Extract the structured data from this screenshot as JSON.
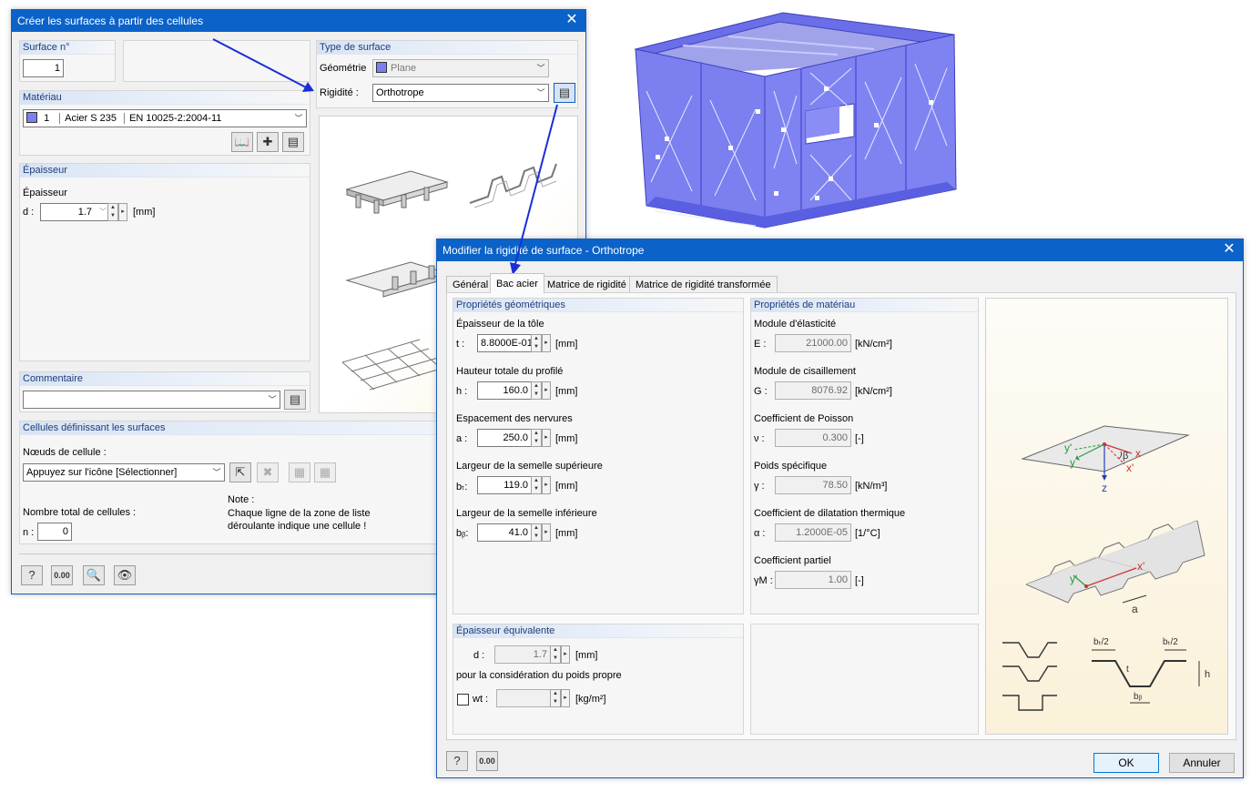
{
  "dialog1": {
    "title": "Créer les surfaces à partir des cellules",
    "surface_label": "Surface n°",
    "surface_no": "1",
    "type_label": "Type de surface",
    "geometry_label": "Géométrie",
    "geometry_value": "Plane",
    "rigidity_label": "Rigidité :",
    "rigidity_value": "Orthotrope",
    "material_label": "Matériau",
    "material_no": "1",
    "material_name": "Acier S 235",
    "material_norm": "EN 10025-2:2004-11",
    "thickness_group": "Épaisseur",
    "thickness_label": "Épaisseur",
    "d_label": "d :",
    "d_value": "1.7",
    "d_unit": "[mm]",
    "comment_label": "Commentaire",
    "comment_value": "",
    "cells_group": "Cellules définissant les surfaces",
    "nodes_label": "Nœuds de cellule :",
    "nodes_value": "Appuyez sur l'icône [Sélectionner]",
    "total_label": "Nombre total de cellules :",
    "n_label": "n :",
    "n_value": "0",
    "note_title": "Note :",
    "note_line1": "Chaque ligne de la zone de liste",
    "note_line2": "déroulante indique une cellule !"
  },
  "dialog2": {
    "title": "Modifier la rigidité de surface - Orthotrope",
    "tabs": [
      "Général",
      "Bac acier",
      "Matrice de rigidité",
      "Matrice de rigidité transformée"
    ],
    "geo_group": "Propriétés géométriques",
    "geo": [
      {
        "label": "Épaisseur de la tôle",
        "sym": "t :",
        "value": "8.8000E-01",
        "unit": "[mm]"
      },
      {
        "label": "Hauteur totale du profilé",
        "sym": "h :",
        "value": "160.0",
        "unit": "[mm]"
      },
      {
        "label": "Espacement des nervures",
        "sym": "a :",
        "value": "250.0",
        "unit": "[mm]"
      },
      {
        "label": "Largeur de la semelle supérieure",
        "sym": "bₜ:",
        "value": "119.0",
        "unit": "[mm]"
      },
      {
        "label": "Largeur de la semelle inférieure",
        "sym": "bᵦ:",
        "value": "41.0",
        "unit": "[mm]"
      }
    ],
    "mat_group": "Propriétés de matériau",
    "mat": [
      {
        "label": "Module d'élasticité",
        "sym": "E :",
        "value": "21000.00",
        "unit": "[kN/cm²]"
      },
      {
        "label": "Module de cisaillement",
        "sym": "G :",
        "value": "8076.92",
        "unit": "[kN/cm²]"
      },
      {
        "label": "Coefficient de Poisson",
        "sym": "ν :",
        "value": "0.300",
        "unit": "[-]"
      },
      {
        "label": "Poids spécifique",
        "sym": "γ :",
        "value": "78.50",
        "unit": "[kN/m³]"
      },
      {
        "label": "Coefficient de dilatation thermique",
        "sym": "α :",
        "value": "1.2000E-05",
        "unit": "[1/°C]"
      },
      {
        "label": "Coefficient partiel",
        "sym": "γM :",
        "value": "1.00",
        "unit": "[-]"
      }
    ],
    "eq_group": "Épaisseur équivalente",
    "eq_d_label": "d :",
    "eq_d_value": "1.7",
    "eq_d_unit": "[mm]",
    "eq_note": "pour la considération du poids propre",
    "wt_label": "wt :",
    "wt_unit": "[kg/m²]",
    "ok": "OK",
    "cancel": "Annuler"
  },
  "diagram_labels": {
    "y_prime": "y'",
    "y": "y",
    "x": "x",
    "x_prime": "x'",
    "beta": "β",
    "z": "z",
    "a": "a",
    "bt_half_left": "bₜ/2",
    "bt_half_right": "bₜ/2",
    "t": "t",
    "h": "h",
    "bb": "bᵦ"
  },
  "colors": {
    "titlebar": "#0b62c8",
    "model": "#7b7ff0",
    "arrow": "#1a2fd6"
  }
}
